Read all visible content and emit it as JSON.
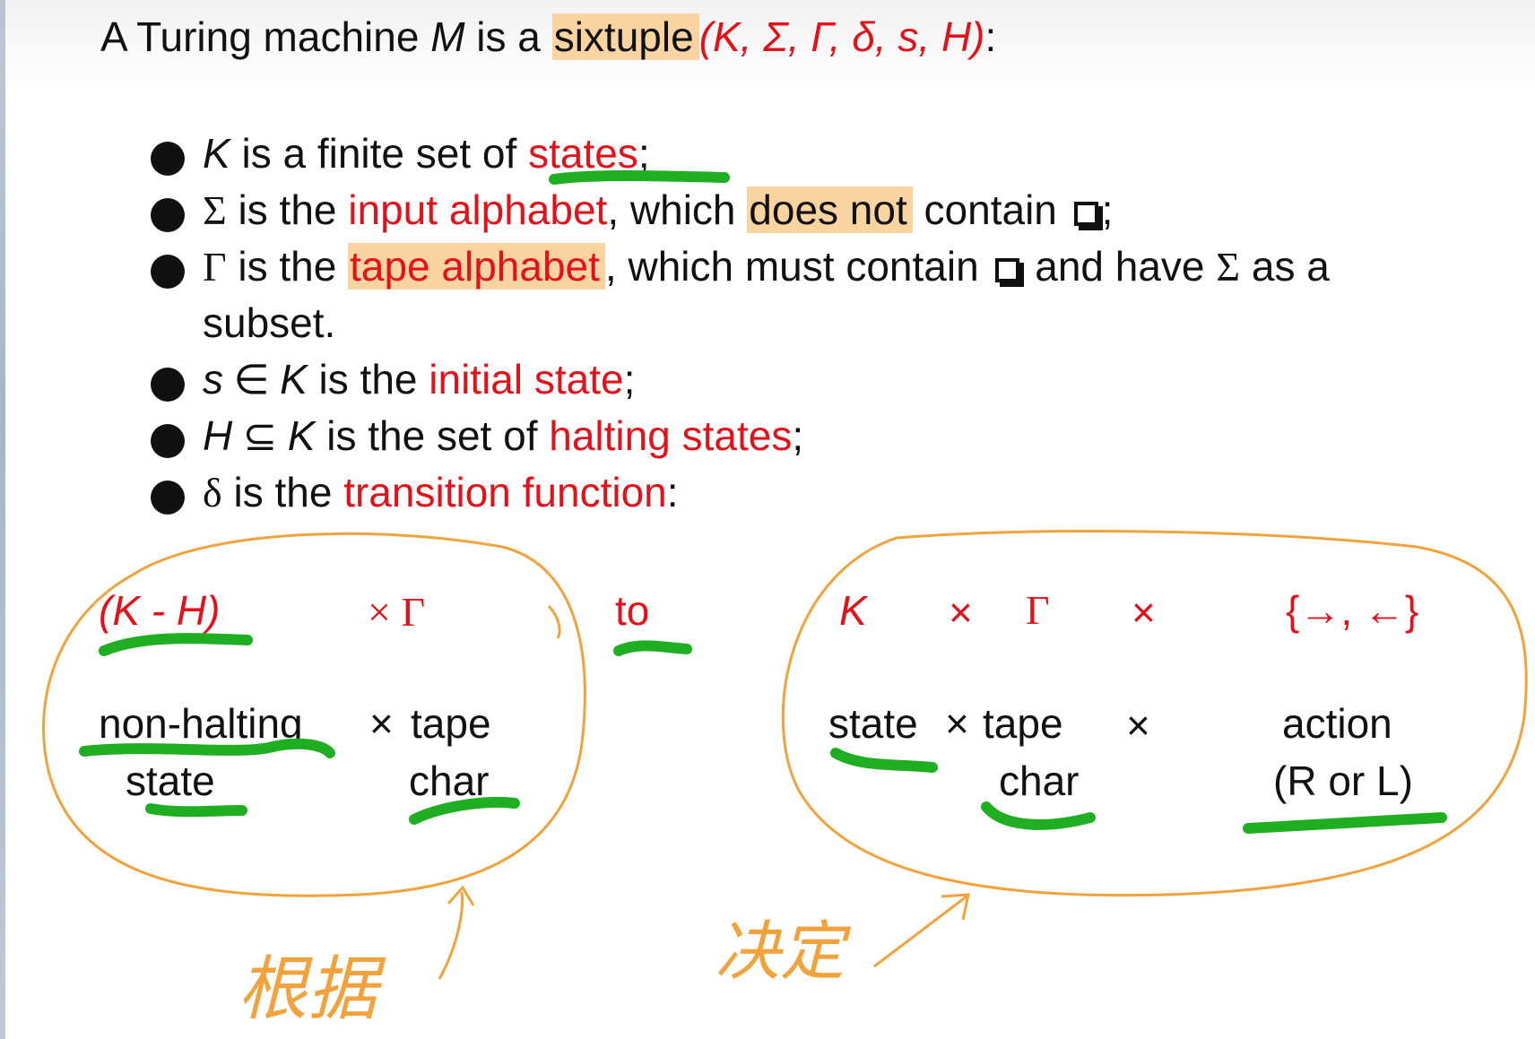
{
  "title": {
    "prefix": "A Turing machine ",
    "machine": "M",
    "is_a": " is a ",
    "sixtuple": "sixtuple",
    "tuple": "(K, Σ, Γ, δ, s, H)",
    "suffix": ":"
  },
  "bullets": {
    "b1": {
      "sym": "K",
      "text": " is a finite set of ",
      "term": "states",
      "end": ";"
    },
    "b2": {
      "sym": "Σ",
      "text": " is the ",
      "term": "input alphabet",
      "mid": ", which ",
      "hl": "does not",
      "rest": " contain ",
      "end": ";"
    },
    "b3": {
      "sym": "Γ",
      "text": " is the ",
      "term": "tape alphabet",
      "mid": ", which must contain ",
      "rest": " and have ",
      "sym2": "Σ",
      "rest2": " as a",
      "cont": "subset."
    },
    "b4": {
      "sym": "s",
      "rel": " ∈ ",
      "sym2": "K",
      "text": " is the ",
      "term": "initial state",
      "end": ";"
    },
    "b5": {
      "sym": "H",
      "rel": " ⊆ ",
      "sym2": "K",
      "text": " is the set of ",
      "term": "halting states",
      "end": ";"
    },
    "b6": {
      "sym": "δ",
      "text": " is the ",
      "term": "transition function",
      "end": ":"
    }
  },
  "domain_part": {
    "expr": "(K - H)",
    "times_gamma": "× Γ",
    "label1a": "non-halting",
    "label1b": "state",
    "times": "×",
    "label2a": "tape",
    "label2b": "char"
  },
  "to": "to",
  "range_part": {
    "k": "K",
    "times1": "×",
    "gamma": "Γ",
    "times2": "×",
    "dirs": "{→, ←}",
    "label1": "state",
    "label_times": "×",
    "label2a": "tape",
    "label2b": "char",
    "label_times2": "×",
    "label3a": "action",
    "label3b": "(R or L)"
  },
  "handwriting": {
    "left_note": "根据",
    "right_note": "决定"
  },
  "colors": {
    "red": "#e3121a",
    "highlight": "#f9d3a0",
    "green_ink": "#1fae22",
    "orange_ink": "#f2a23c"
  }
}
